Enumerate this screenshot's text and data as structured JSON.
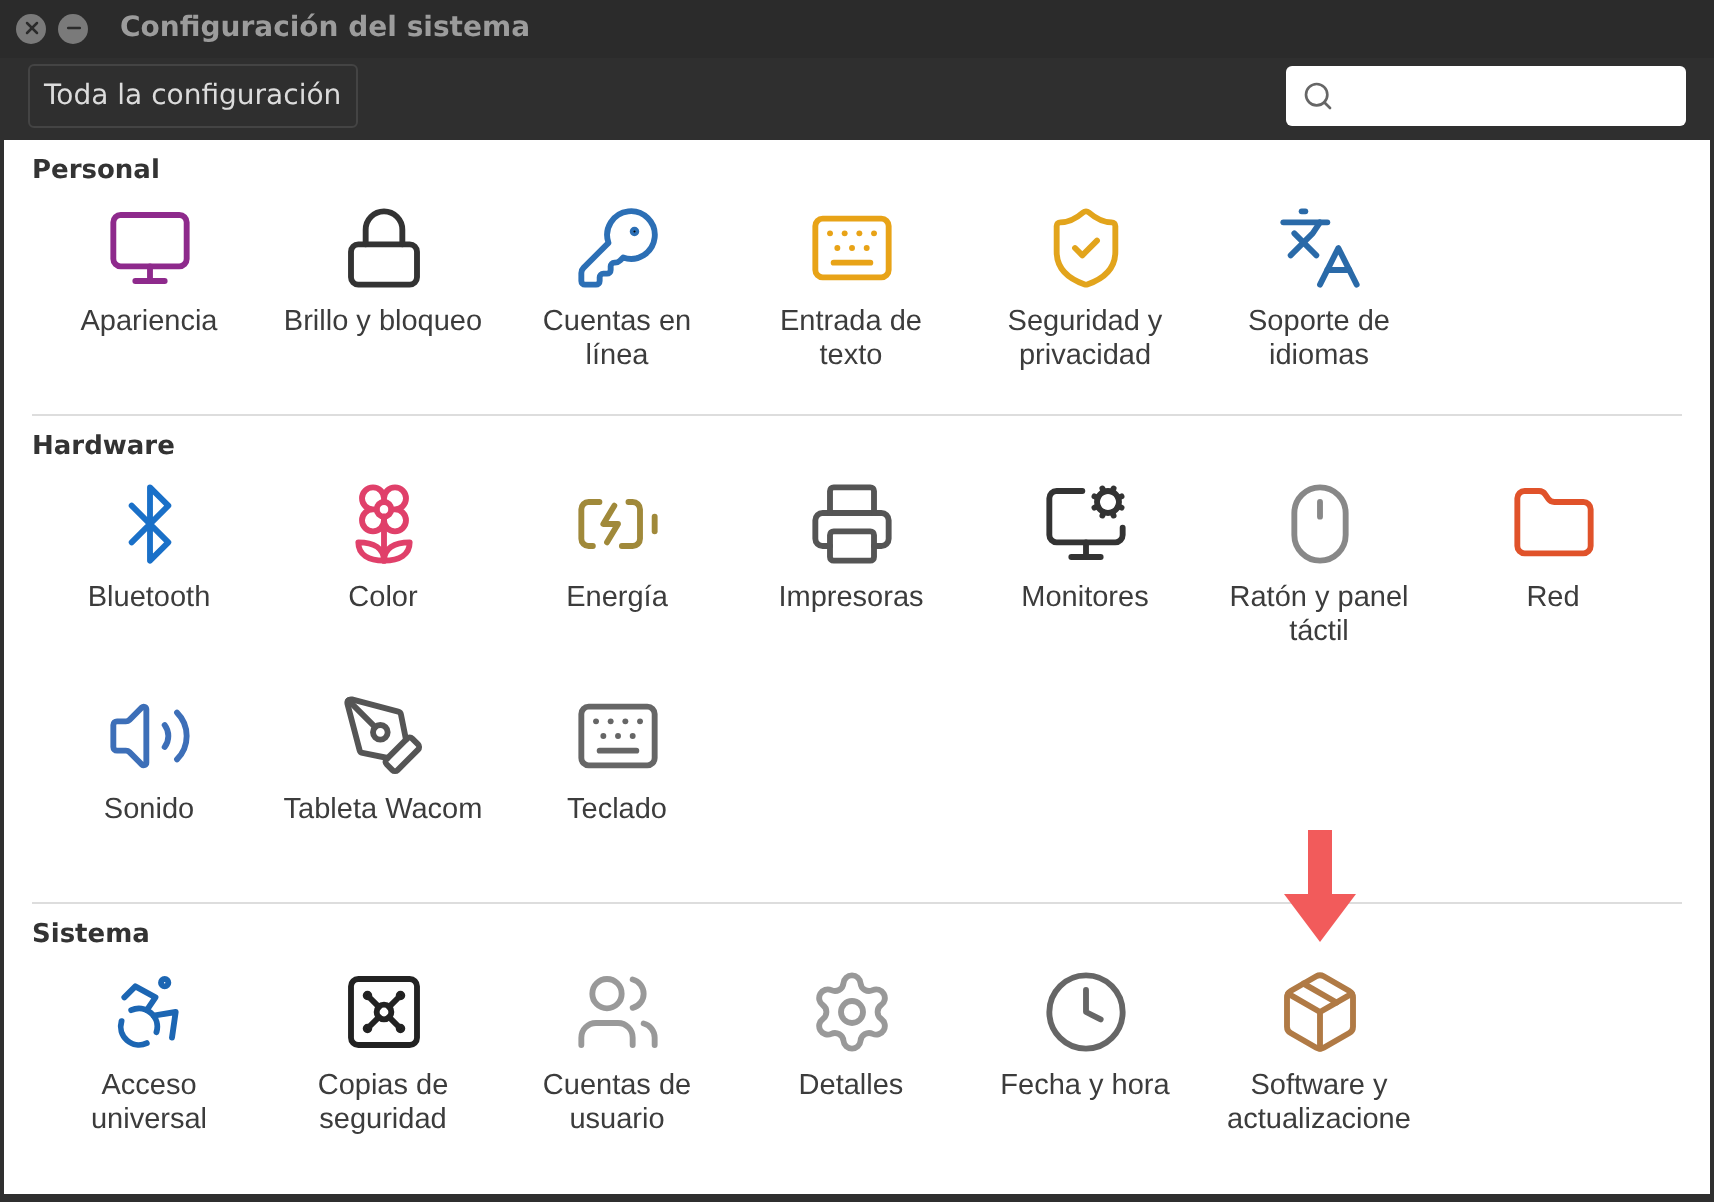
{
  "window": {
    "title": "Configuración del sistema"
  },
  "toolbar": {
    "all_settings_button": "Toda la configuración"
  },
  "sections": [
    {
      "title": "Personal",
      "items": [
        {
          "label": "Apariencia",
          "marked": false
        },
        {
          "label": "Brillo y bloqueo",
          "marked": false
        },
        {
          "label": "Cuentas en línea",
          "marked": false
        },
        {
          "label": "Entrada de texto",
          "marked": false
        },
        {
          "label": "Seguridad y privacidad",
          "marked": false
        },
        {
          "label": "Soporte de idiomas",
          "marked": false
        }
      ]
    },
    {
      "title": "Hardware",
      "items": [
        {
          "label": "Bluetooth",
          "marked": false
        },
        {
          "label": "Color",
          "marked": false
        },
        {
          "label": "Energía",
          "marked": false
        },
        {
          "label": "Impresoras",
          "marked": false
        },
        {
          "label": "Monitores",
          "marked": false
        },
        {
          "label": "Ratón y panel táctil",
          "marked": false
        },
        {
          "label": "Red",
          "marked": false
        },
        {
          "label": "Sonido",
          "marked": false
        },
        {
          "label": "Tableta Wacom",
          "marked": false
        },
        {
          "label": "Teclado",
          "marked": false
        }
      ]
    },
    {
      "title": "Sistema",
      "items": [
        {
          "label": "Acceso universal",
          "marked": false
        },
        {
          "label": "Copias de seguridad",
          "marked": false
        },
        {
          "label": "Cuentas de usuario",
          "marked": false
        },
        {
          "label": "Detalles",
          "marked": false
        },
        {
          "label": "Fecha y hora",
          "marked": false
        },
        {
          "label": "Software y actualizacione",
          "marked": true
        }
      ]
    }
  ]
}
